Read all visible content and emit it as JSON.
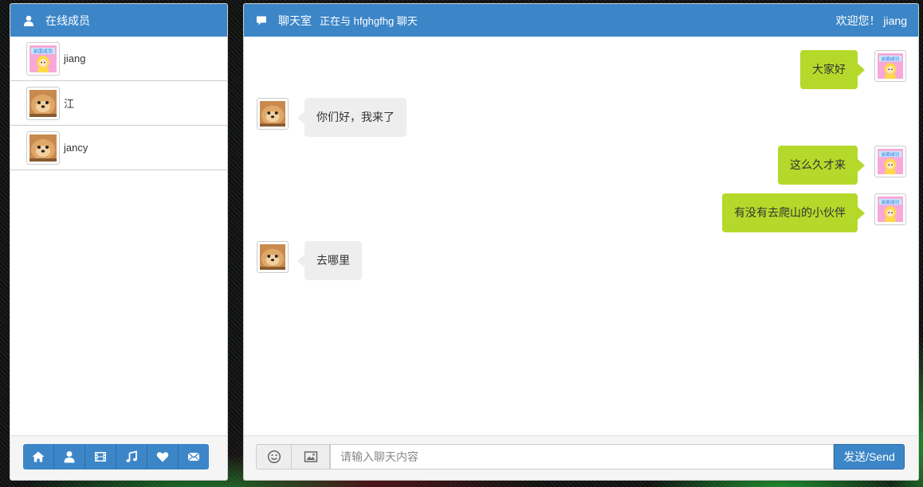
{
  "colors": {
    "accent": "#3c86c8",
    "my_bubble": "#b5d92a",
    "other_bubble": "#eeeeee"
  },
  "members_panel": {
    "title": "在线成员",
    "icon": "user-icon",
    "members": [
      {
        "name": "jiang",
        "avatar": "cartoon-girl-avatar"
      },
      {
        "name": "江",
        "avatar": "dog-avatar"
      },
      {
        "name": "jancy",
        "avatar": "dog-avatar"
      }
    ],
    "toolbar": [
      "home-icon",
      "user-icon",
      "film-icon",
      "music-icon",
      "heart-icon",
      "envelope-icon"
    ]
  },
  "chat_panel": {
    "icon": "comment-icon",
    "title": "聊天室",
    "subtitle": "正在与 hfghgfhg 聊天",
    "welcome": "欢迎您！ jiang",
    "messages": [
      {
        "from": "me",
        "text": "大家好",
        "avatar": "cartoon-girl-avatar"
      },
      {
        "from": "other",
        "text": "你们好，我来了",
        "avatar": "dog-avatar"
      },
      {
        "from": "me",
        "text": "这么久才来",
        "avatar": "cartoon-girl-avatar"
      },
      {
        "from": "me",
        "text": "有没有去爬山的小伙伴",
        "avatar": "cartoon-girl-avatar"
      },
      {
        "from": "other",
        "text": "去哪里",
        "avatar": "dog-avatar"
      }
    ],
    "input": {
      "placeholder": "请输入聊天内容",
      "value": ""
    },
    "emoji_button_icon": "smile-icon",
    "image_button_icon": "picture-icon",
    "send_label": "发送/Send"
  }
}
